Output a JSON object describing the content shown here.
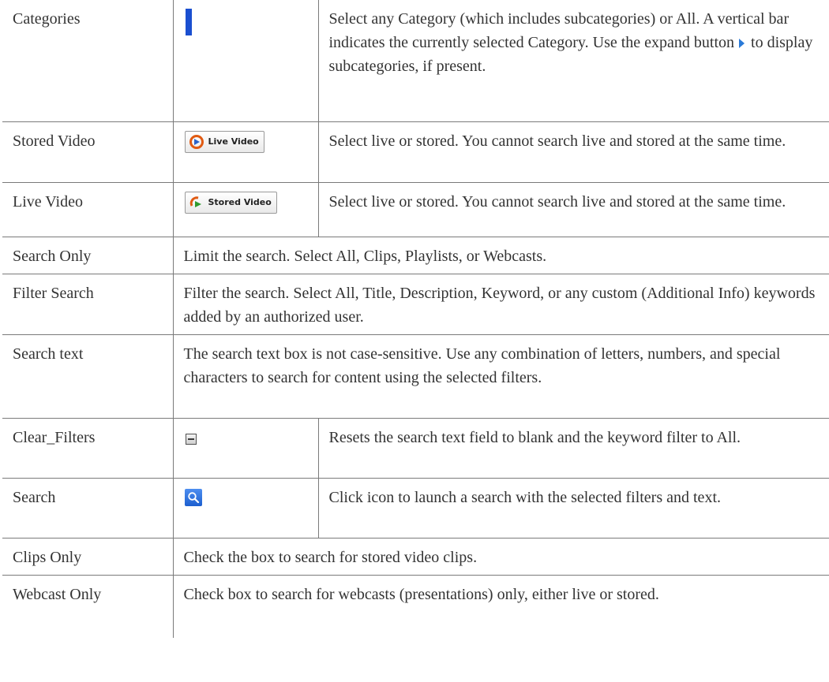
{
  "rows": [
    {
      "label": "Categories",
      "icon": "vertical-bar-icon",
      "description_part1": "Select any Category (which includes subcategories) or All. A vertical bar indicates the currently selected Category. Use the expand button",
      "description_part2": "to display subcategories, if present."
    },
    {
      "label": "Stored Video",
      "button_label": "Live Video",
      "icon": "live-video-icon",
      "description": "Select live or stored. You cannot search live and stored at the same time."
    },
    {
      "label": "Live Video",
      "button_label": "Stored Video",
      "icon": "stored-video-icon",
      "description": "Select live or stored. You cannot search live and stored at the same time."
    },
    {
      "label": "Search Only",
      "description": "Limit the search. Select All, Clips, Playlists, or Webcasts."
    },
    {
      "label": "Filter Search",
      "description": "Filter the search. Select All, Title, Description, Keyword, or any custom (Additional Info) keywords added by an authorized user."
    },
    {
      "label": "Search text",
      "description": "The search text box is not case-sensitive. Use any combination of letters, numbers, and special characters to search for content using the selected filters."
    },
    {
      "label": "Clear_Filters",
      "icon": "clear-filters-icon",
      "description": "Resets the search text field to blank and the keyword filter to All."
    },
    {
      "label": "Search",
      "icon": "search-icon",
      "description": "Click icon to launch a search with the selected filters and text."
    },
    {
      "label": "Clips Only",
      "description": "Check the box to search for stored video clips."
    },
    {
      "label": "Webcast Only",
      "description": "Check box to search for webcasts (presentations) only, either live or stored."
    }
  ],
  "colors": {
    "accent_blue": "#1a4fd0",
    "border": "#7a7a7a",
    "text": "#333333"
  }
}
